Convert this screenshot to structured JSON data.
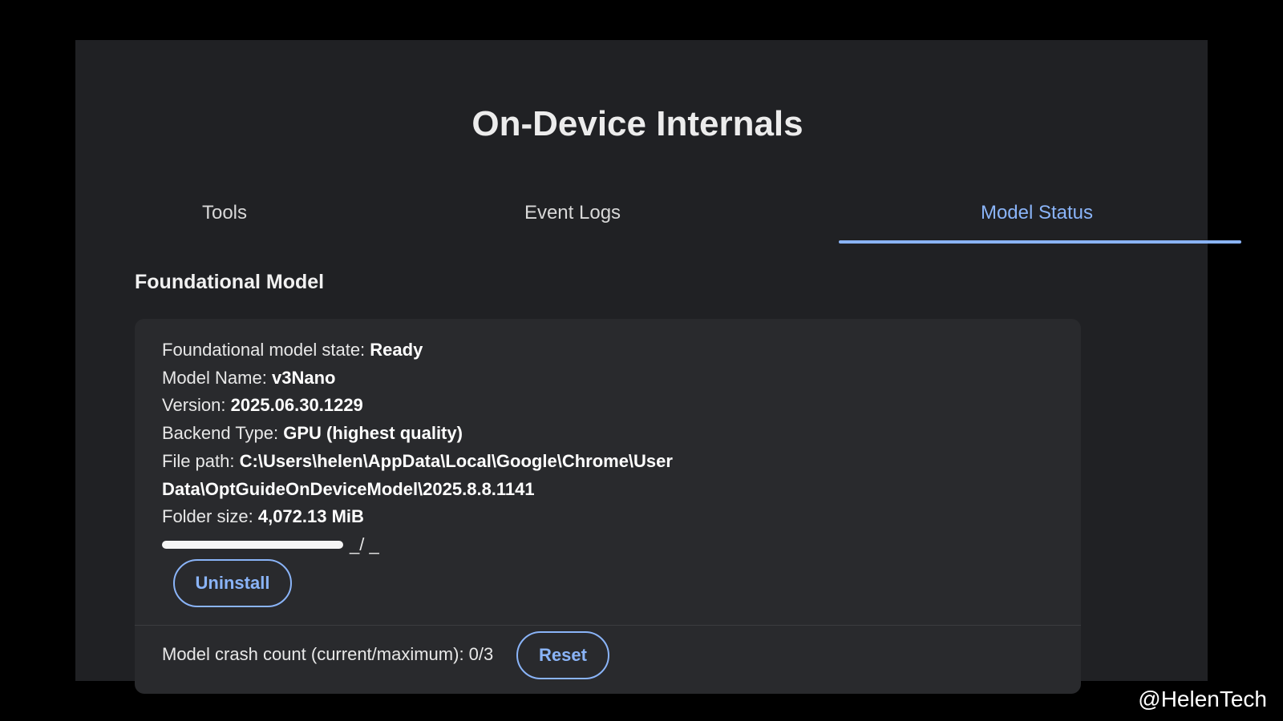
{
  "page": {
    "title": "On-Device Internals"
  },
  "tabs": [
    {
      "label": "Tools",
      "active": false
    },
    {
      "label": "Event Logs",
      "active": false
    },
    {
      "label": "Model Status",
      "active": true
    }
  ],
  "section": {
    "title": "Foundational Model"
  },
  "model_info": {
    "state_label": "Foundational model state:",
    "state_value": "Ready",
    "name_label": "Model Name:",
    "name_value": "v3Nano",
    "version_label": "Version:",
    "version_value": "2025.06.30.1229",
    "backend_label": "Backend Type:",
    "backend_value": "GPU (highest quality)",
    "path_label": "File path:",
    "path_value_line1": "C:\\Users\\helen\\AppData\\Local\\Google\\Chrome\\User",
    "path_value_line2": "Data\\OptGuideOnDeviceModel\\2025.8.8.1141",
    "folder_size_label": "Folder size:",
    "folder_size_value": "4,072.13 MiB"
  },
  "progress": {
    "fraction": 1.0,
    "text": "_/ _"
  },
  "buttons": {
    "uninstall_label": "Uninstall",
    "reset_label": "Reset"
  },
  "crash": {
    "label": "Model crash count (current/maximum): 0/3"
  },
  "watermark": "@HelenTech",
  "colors": {
    "background": "#000000",
    "panel": "#202124",
    "card": "#292a2d",
    "accent": "#8ab4f8",
    "text": "#e8e8e8"
  }
}
